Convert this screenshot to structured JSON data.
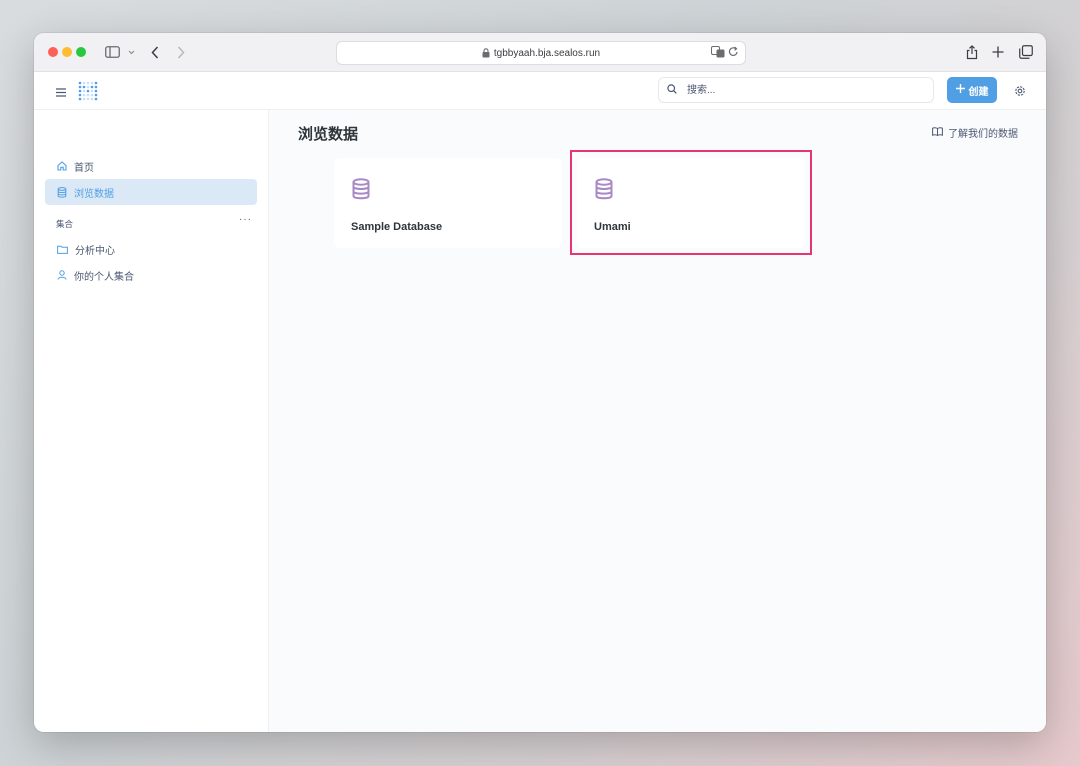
{
  "browser": {
    "url": "tgbbyaah.bja.sealos.run"
  },
  "header": {
    "search_placeholder": "搜索...",
    "create_label": "创建"
  },
  "sidebar": {
    "items": [
      {
        "label": "首页",
        "icon": "home-icon"
      },
      {
        "label": "浏览数据",
        "icon": "database-icon"
      }
    ],
    "section_label": "集合",
    "section_more": "···",
    "collections": [
      {
        "label": "分析中心",
        "icon": "folder-icon"
      },
      {
        "label": "你的个人集合",
        "icon": "person-icon"
      }
    ]
  },
  "main": {
    "title": "浏览数据",
    "learn_link": "了解我们的数据",
    "databases": [
      {
        "name": "Sample Database",
        "icon": "database-icon"
      },
      {
        "name": "Umami",
        "icon": "database-icon"
      }
    ]
  },
  "colors": {
    "brand_blue": "#509ee3",
    "highlight": "#e6356f",
    "db_icon": "#a989c5"
  }
}
